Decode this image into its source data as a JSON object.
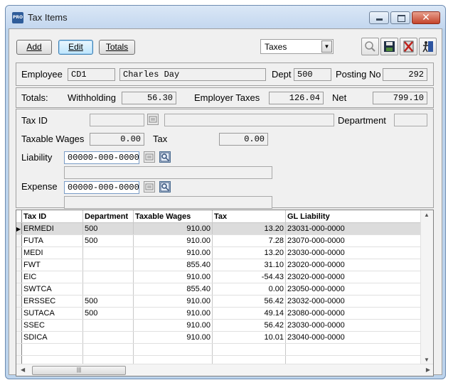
{
  "window": {
    "title": "Tax Items",
    "app_icon_text": "PRO"
  },
  "toolbar": {
    "add": "Add",
    "edit": "Edit",
    "totals": "Totals",
    "view_select": "Taxes"
  },
  "employee": {
    "label": "Employee",
    "code": "CD1",
    "name": "Charles Day",
    "dept_label": "Dept",
    "dept": "500",
    "posting_label": "Posting No",
    "posting": "292"
  },
  "totals": {
    "label": "Totals:",
    "withholding_label": "Withholding",
    "withholding": "56.30",
    "employer_label": "Employer Taxes",
    "employer": "126.04",
    "net_label": "Net",
    "net": "799.10"
  },
  "detail": {
    "taxid_label": "Tax ID",
    "taxid": "",
    "taxid_desc": "",
    "department_label": "Department",
    "department": "",
    "taxable_wages_label": "Taxable Wages",
    "taxable_wages": "0.00",
    "tax_label": "Tax",
    "tax": "0.00",
    "liability_label": "Liability",
    "liability": "00000-000-0000",
    "liability_desc": "",
    "expense_label": "Expense",
    "expense": "00000-000-0000",
    "expense_desc": ""
  },
  "grid": {
    "headers": [
      "Tax ID",
      "Department",
      "Taxable Wages",
      "Tax",
      "GL Liability"
    ],
    "rows": [
      [
        "ERMEDI",
        "500",
        "910.00",
        "13.20",
        "23031-000-0000"
      ],
      [
        "FUTA",
        "500",
        "910.00",
        "7.28",
        "23070-000-0000"
      ],
      [
        "MEDI",
        "",
        "910.00",
        "13.20",
        "23030-000-0000"
      ],
      [
        "FWT",
        "",
        "855.40",
        "31.10",
        "23020-000-0000"
      ],
      [
        "EIC",
        "",
        "910.00",
        "-54.43",
        "23020-000-0000"
      ],
      [
        "SWTCA",
        "",
        "855.40",
        "0.00",
        "23050-000-0000"
      ],
      [
        "ERSSEC",
        "500",
        "910.00",
        "56.42",
        "23032-000-0000"
      ],
      [
        "SUTACA",
        "500",
        "910.00",
        "49.14",
        "23080-000-0000"
      ],
      [
        "SSEC",
        "",
        "910.00",
        "56.42",
        "23030-000-0000"
      ],
      [
        "SDICA",
        "",
        "910.00",
        "10.01",
        "23040-000-0000"
      ]
    ],
    "empty_rows": 2,
    "selected_row": 0
  },
  "icons": {
    "toolbar": [
      "search-icon",
      "save-icon",
      "delete-icon",
      "exit-icon"
    ],
    "lookup": "lookup-icon",
    "gl_search": "gl-search-icon"
  }
}
